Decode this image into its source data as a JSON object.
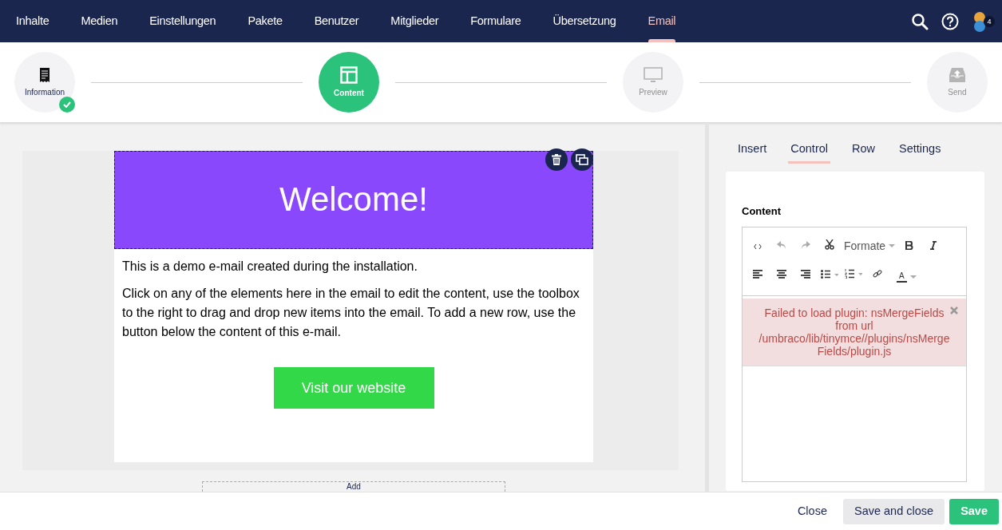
{
  "nav": {
    "items": [
      {
        "label": "Inhalte",
        "selected": false
      },
      {
        "label": "Medien",
        "selected": false
      },
      {
        "label": "Einstellungen",
        "selected": false
      },
      {
        "label": "Pakete",
        "selected": false
      },
      {
        "label": "Benutzer",
        "selected": false
      },
      {
        "label": "Mitglieder",
        "selected": false
      },
      {
        "label": "Formulare",
        "selected": false
      },
      {
        "label": "Übersetzung",
        "selected": false
      },
      {
        "label": "Email",
        "selected": true
      }
    ],
    "user_badge": "4"
  },
  "steps": [
    {
      "label": "Information",
      "kind": "done"
    },
    {
      "label": "Content",
      "kind": "active"
    },
    {
      "label": "Preview",
      "kind": "pending"
    },
    {
      "label": "Send",
      "kind": "pending"
    }
  ],
  "email": {
    "heading": "Welcome!",
    "paragraphs": [
      "This is a demo e-mail created during the installation.",
      "Click on any of the elements here in the email to edit the content, use the toolbox to the right to drag and drop new items into the email. To add a new row, use the button below the content of this e-mail."
    ],
    "button": "Visit our website",
    "add_label": "Add"
  },
  "panel": {
    "tabs": [
      {
        "label": "Insert",
        "selected": false
      },
      {
        "label": "Control",
        "selected": true
      },
      {
        "label": "Row",
        "selected": false
      },
      {
        "label": "Settings",
        "selected": false
      }
    ],
    "field_label": "Content",
    "format_label": "Formate",
    "color_letter": "A",
    "error": "Failed to load plugin: nsMergeFields from url /umbraco/lib/tinymce//plugins/nsMergeFields/plugin.js"
  },
  "footer": {
    "buttons": [
      {
        "label": "Close",
        "kind": "link"
      },
      {
        "label": "Save and close",
        "kind": "secondary"
      },
      {
        "label": "Save",
        "kind": "primary"
      }
    ]
  }
}
